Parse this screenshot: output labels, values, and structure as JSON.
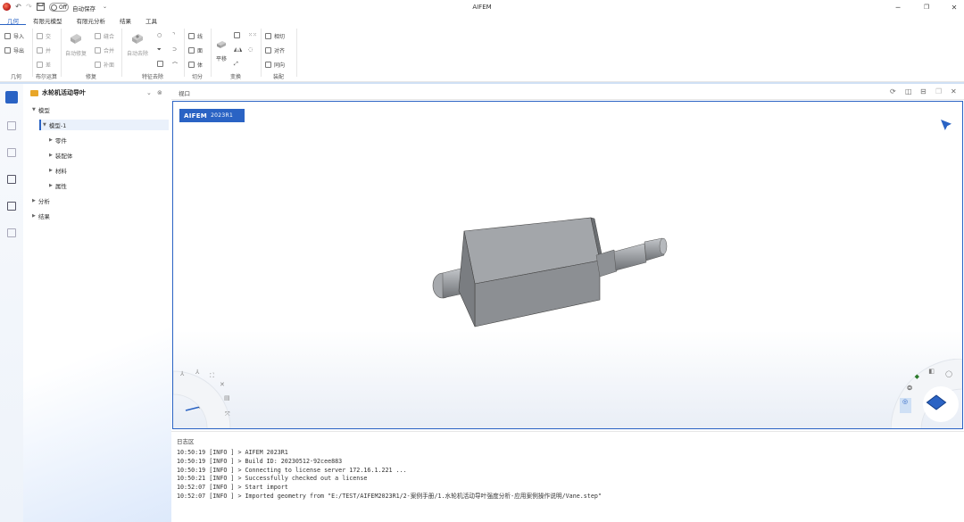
{
  "titlebar": {
    "app_title": "AIFEM",
    "autosave_state": "Off",
    "autosave_label": "自动保存"
  },
  "menu": {
    "items": [
      "几何",
      "有限元模型",
      "有限元分析",
      "结果",
      "工具"
    ]
  },
  "ribbon": {
    "geometry": {
      "label": "几何",
      "import": "导入",
      "export": "导出"
    },
    "boolean": {
      "label": "布尔运算",
      "intersect": "交",
      "union": "并",
      "subtract": "差"
    },
    "repair": {
      "label": "修复",
      "auto_repair": "自动修复",
      "stitch": "缝合",
      "merge": "合并",
      "fill": "补面"
    },
    "feature": {
      "label": "特征去除",
      "auto_remove": "自动去除"
    },
    "cut": {
      "label": "切分",
      "line": "线",
      "face": "面",
      "body": "体"
    },
    "transform": {
      "label": "变换",
      "translate": "平移"
    },
    "assembly": {
      "label": "装配",
      "tangent": "相切",
      "align": "对齐",
      "coaxial": "同向"
    }
  },
  "tree": {
    "title": "水轮机活动导叶",
    "nodes": {
      "model": "模型",
      "model1": "模型-1",
      "parts": "零件",
      "assembly": "装配体",
      "material": "材料",
      "property": "属性",
      "analysis": "分析",
      "result": "结果"
    }
  },
  "viewport": {
    "title": "视口",
    "badge_brand": "AIFEM",
    "badge_version": "2023R1"
  },
  "log": {
    "title": "日志区",
    "lines": [
      "10:50:19 [INFO ] > AIFEM 2023R1",
      "10:50:19 [INFO ] > Build ID: 20230512-92cee883",
      "10:50:19 [INFO ] > Connecting to license server 172.16.1.221 ...",
      "10:50:21 [INFO ] > Successfully checked out a license",
      "10:52:07 [INFO ] > Start import",
      "10:52:07 [INFO ] > Imported geometry from \"E:/TEST/AIFEM2023R1/2-案例手册/1.水轮机活动导叶强度分析-应用案例操作说明/Vane.step\""
    ]
  },
  "colors": {
    "accent": "#2a63c4",
    "folder": "#e8a628",
    "part": "#8c8f93"
  }
}
